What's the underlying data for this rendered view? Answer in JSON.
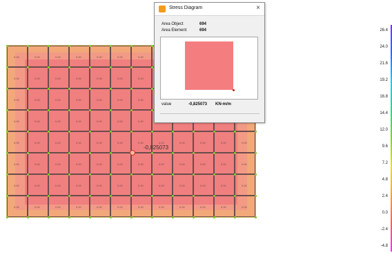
{
  "dialog": {
    "title": "Stress Diagram",
    "close_label": "×",
    "fields": [
      {
        "label": "Area Object",
        "value": "694"
      },
      {
        "label": "Area Element",
        "value": "694"
      }
    ],
    "value_label": "value",
    "value": "-0,825073",
    "value_unit": "KN-m/m"
  },
  "diagram": {
    "point_label": "-0,825073",
    "cell_label": "0.00"
  },
  "legend": {
    "labels": [
      "26.4",
      "24.0",
      "21.6",
      "19.2",
      "16.8",
      "14.4",
      "12.0",
      "9.6",
      "7.2",
      "4.8",
      "2.4",
      "0.0",
      "-2.4",
      "-4.8"
    ],
    "colors": [
      "#7b2ff7",
      "#1f6cff",
      "#1ec7ff",
      "#22d98b",
      "#7dd42a",
      "#e7e221",
      "#ff9f2b",
      "#ff5b5b",
      "#e03ee8"
    ]
  }
}
